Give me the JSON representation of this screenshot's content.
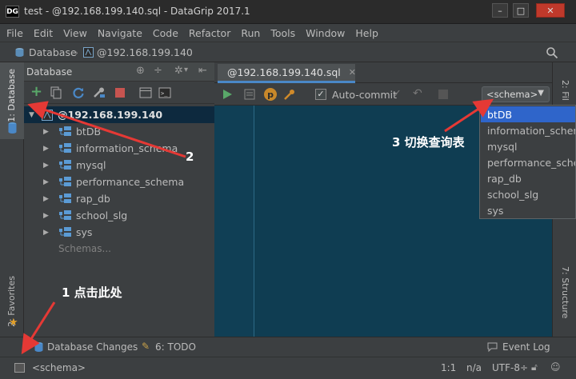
{
  "window": {
    "logo": "DG",
    "title": "test - @192.168.199.140.sql - DataGrip 2017.1",
    "min": "–",
    "max": "□",
    "close": "✕"
  },
  "menu": [
    "File",
    "Edit",
    "View",
    "Navigate",
    "Code",
    "Refactor",
    "Run",
    "Tools",
    "Window",
    "Help"
  ],
  "breadcrumb": {
    "root": "Database",
    "host": "@192.168.199.140"
  },
  "left_strip": {
    "database_tab": "1: Database",
    "favorites_tab": "2: Favorites"
  },
  "right_strip": {
    "files_tab": "2: Fil",
    "structure_tab": "7: Structure"
  },
  "db_panel": {
    "title": "Database",
    "root": "@192.168.199.140",
    "schemas": [
      "btDB",
      "information_schema",
      "mysql",
      "performance_schema",
      "rap_db",
      "school_slg",
      "sys"
    ],
    "more": "Schemas..."
  },
  "editor": {
    "tab_label": "@192.168.199.140.sql",
    "autocommit_label": "Auto-commit",
    "schema_select": "<schema>",
    "dropdown_options": [
      "btDB",
      "information_schema",
      "mysql",
      "performance_schema",
      "rap_db",
      "school_slg",
      "sys"
    ],
    "dropdown_selected": "btDB"
  },
  "bottom_tools": {
    "db_changes": "Database Changes",
    "todo": "6: TODO",
    "event_log": "Event Log"
  },
  "status": {
    "schema": "<schema>",
    "position": "1:1",
    "na": "n/a",
    "encoding": "UTF-8÷"
  },
  "annotations": {
    "a1": "1 点击此处",
    "a2": "2",
    "a3": "3 切换查询表"
  },
  "colors": {
    "accent": "#2f65ca",
    "arrow": "#e53935",
    "editor_bg": "#0f3d52",
    "selection": "#0d293e"
  }
}
